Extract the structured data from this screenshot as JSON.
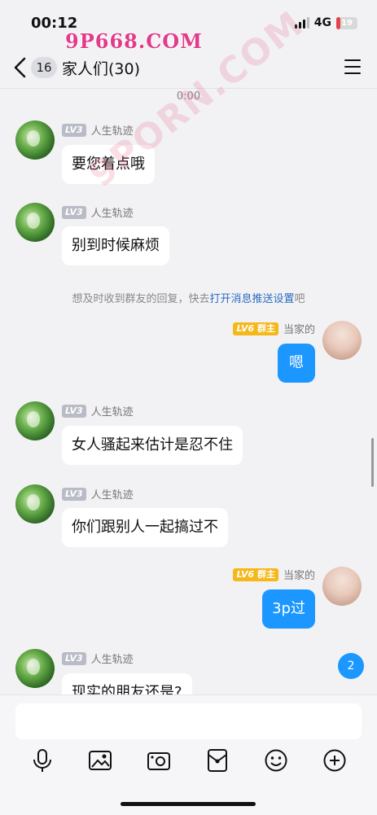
{
  "status_bar": {
    "time": "00:12",
    "network": "4G",
    "battery": "19",
    "battery_fraction": 0.19
  },
  "watermark": {
    "top": "9P668.COM",
    "diagonal": "9PORN.COM"
  },
  "header": {
    "unread_count": "16",
    "title": "家人们(30)"
  },
  "chat": {
    "timestamp": "0:00",
    "notice": {
      "prefix": "想及时收到群友的回复，快去",
      "link": "打开消息推送设置",
      "suffix": "吧"
    },
    "messages": [
      {
        "sender": "人生轨迹",
        "level": "LV3",
        "side": "left",
        "text": "要您着点哦"
      },
      {
        "sender": "人生轨迹",
        "level": "LV3",
        "side": "left",
        "text": "别到时候麻烦"
      },
      {
        "sender": "当家的",
        "level": "LV6",
        "role": "群主",
        "side": "right",
        "text": "嗯"
      },
      {
        "sender": "人生轨迹",
        "level": "LV3",
        "side": "left",
        "text": "女人骚起来估计是忍不住"
      },
      {
        "sender": "人生轨迹",
        "level": "LV3",
        "side": "left",
        "text": "你们跟别人一起搞过不"
      },
      {
        "sender": "当家的",
        "level": "LV6",
        "role": "群主",
        "side": "right",
        "text": "3p过"
      },
      {
        "sender": "人生轨迹",
        "level": "LV3",
        "side": "left",
        "text": "现实的朋友还是?"
      }
    ],
    "new_message_badge": "2"
  },
  "toolbar_icons": [
    "microphone-icon",
    "image-icon",
    "camera-icon",
    "red-packet-icon",
    "emoji-icon",
    "plus-icon"
  ],
  "colors": {
    "accent": "#1b97ff",
    "owner_badge": "#f5b819",
    "link": "#2b6cc2"
  }
}
